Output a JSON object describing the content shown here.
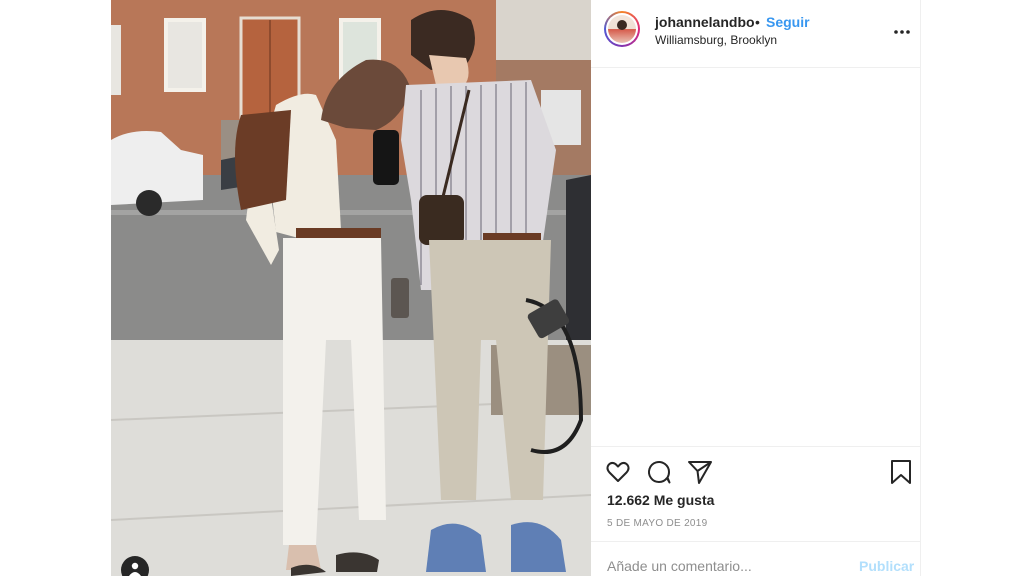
{
  "post": {
    "username": "johannelandbo",
    "separator": "•",
    "follow_label": "Seguir",
    "location": "Williamsburg, Brooklyn",
    "likes_text": "12.662 Me gusta",
    "date": "5 DE MAYO DE 2019",
    "comment_placeholder": "Añade un comentario...",
    "publish_label": "Publicar"
  },
  "icons": {
    "more": "more-options-icon",
    "like": "heart-icon",
    "comment": "comment-icon",
    "share": "paper-plane-icon",
    "save": "bookmark-icon",
    "tag": "user-tag-icon"
  },
  "colors": {
    "link_blue": "#3897f0",
    "disabled_blue": "#b2dffc",
    "text": "#262626",
    "muted": "#8e8e8e",
    "border": "#efefef"
  }
}
